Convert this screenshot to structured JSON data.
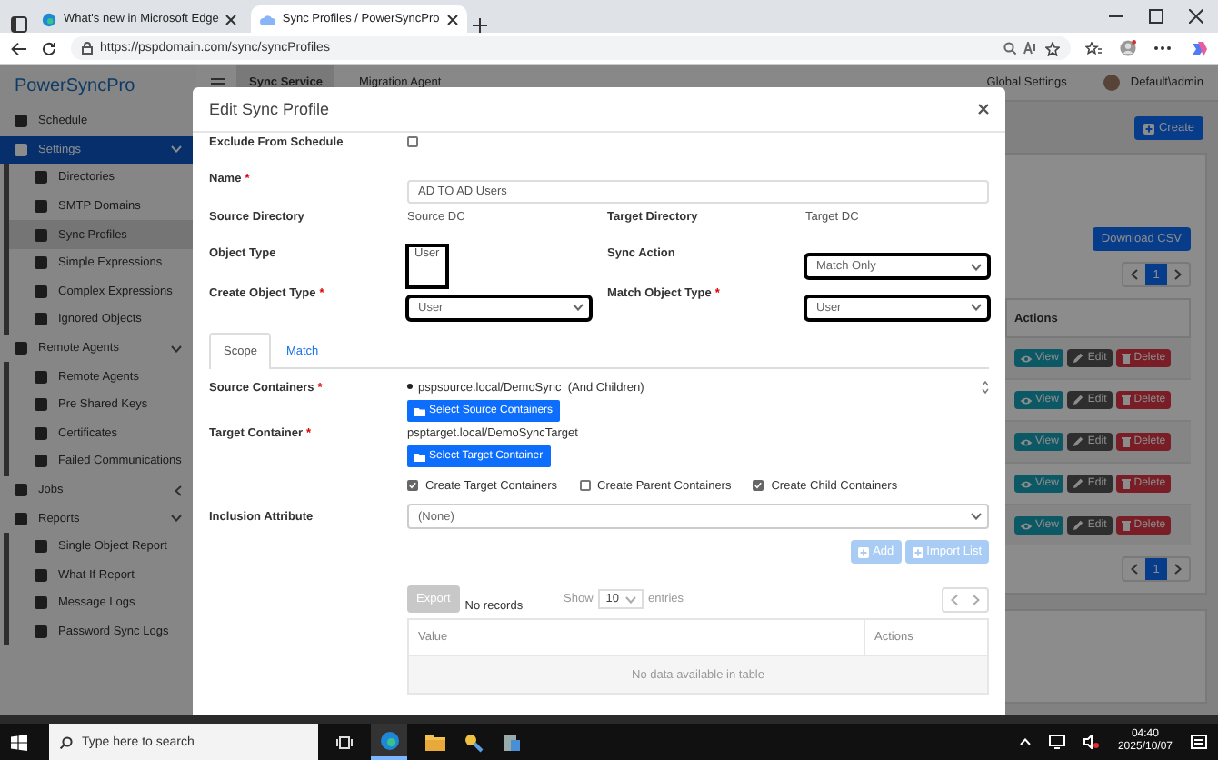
{
  "browser": {
    "tabs": [
      {
        "title": "What's new in Microsoft Edge",
        "selected": false
      },
      {
        "title": "Sync Profiles / PowerSyncPro",
        "selected": true
      }
    ],
    "url": "https://pspdomain.com/sync/syncProfiles"
  },
  "app": {
    "logo": "PowerSyncPro",
    "top_nav": [
      {
        "label": "Sync Service",
        "selected": true
      },
      {
        "label": "Migration Agent",
        "selected": false
      }
    ],
    "global_settings": "Global Settings",
    "user": "Default\\admin"
  },
  "sidebar": {
    "items": [
      {
        "label": "Schedule",
        "selected": false
      },
      {
        "label": "Settings",
        "selected": true,
        "expanded": true,
        "children": [
          {
            "label": "Directories",
            "selected": false
          },
          {
            "label": "SMTP Domains",
            "selected": false
          },
          {
            "label": "Sync Profiles",
            "selected": true
          },
          {
            "label": "Simple Expressions",
            "selected": false
          },
          {
            "label": "Complex Expressions",
            "selected": false
          },
          {
            "label": "Ignored Objects",
            "selected": false
          }
        ]
      },
      {
        "label": "Remote Agents",
        "selected": false,
        "expanded": true,
        "children": [
          {
            "label": "Remote Agents",
            "selected": false
          },
          {
            "label": "Pre Shared Keys",
            "selected": false
          },
          {
            "label": "Certificates",
            "selected": false
          },
          {
            "label": "Failed Communications",
            "selected": false
          }
        ]
      },
      {
        "label": "Jobs",
        "selected": false,
        "expanded": false
      },
      {
        "label": "Reports",
        "selected": false,
        "expanded": true,
        "children": [
          {
            "label": "Single Object Report",
            "selected": false
          },
          {
            "label": "What If Report",
            "selected": false
          },
          {
            "label": "Message Logs",
            "selected": false
          },
          {
            "label": "Password Sync Logs",
            "selected": false
          }
        ]
      }
    ]
  },
  "background": {
    "create_button": "Create",
    "download_button": "Download CSV",
    "pagers": [
      {
        "pages": [
          {
            "label": "1",
            "selected": true
          }
        ]
      },
      {
        "pages": [
          {
            "label": "1",
            "selected": true
          }
        ]
      }
    ],
    "table": {
      "columns": [
        "Actions"
      ],
      "rows": [
        {
          "actions": [
            "View",
            "Edit",
            "Delete"
          ]
        },
        {
          "actions": [
            "View",
            "Edit",
            "Delete"
          ]
        },
        {
          "actions": [
            "View",
            "Edit",
            "Delete"
          ]
        },
        {
          "actions": [
            "View",
            "Edit",
            "Delete"
          ]
        },
        {
          "actions": [
            "View",
            "Edit",
            "Delete"
          ]
        }
      ]
    }
  },
  "modal": {
    "title": "Edit Sync Profile",
    "exclude_from_schedule": {
      "label": "Exclude From Schedule",
      "checked": false
    },
    "name": {
      "label": "Name",
      "required_mark": "*",
      "value": "AD TO AD Users"
    },
    "source_directory": {
      "label": "Source Directory",
      "value": "Source DC"
    },
    "target_directory": {
      "label": "Target Directory",
      "value": "Target DC"
    },
    "object_type": {
      "label": "Object Type",
      "value": "User",
      "highlighted": true
    },
    "sync_action": {
      "label": "Sync Action",
      "value": "Match Only",
      "highlighted": true
    },
    "create_object_type": {
      "label": "Create Object Type",
      "required_mark": "*",
      "value": "User",
      "highlighted": true
    },
    "match_object_type": {
      "label": "Match Object Type",
      "required_mark": "*",
      "value": "User",
      "highlighted": true
    },
    "tabs": [
      {
        "label": "Scope",
        "selected": true
      },
      {
        "label": "Match",
        "selected": false
      }
    ],
    "source_containers": {
      "label": "Source Containers",
      "required_mark": "*",
      "items": [
        "pspsource.local/DemoSync  (And Children)"
      ],
      "button": "Select Source Containers"
    },
    "target_container": {
      "label": "Target Container",
      "required_mark": "*",
      "value": "psptarget.local/DemoSyncTarget",
      "button": "Select Target Container"
    },
    "container_options": [
      {
        "label": "Create Target Containers",
        "checked": true
      },
      {
        "label": "Create Parent Containers",
        "checked": false
      },
      {
        "label": "Create Child Containers",
        "checked": true
      }
    ],
    "inclusion_attribute": {
      "label": "Inclusion Attribute",
      "value": "(None)"
    },
    "list_buttons": [
      {
        "label": "Add",
        "disabled": true
      },
      {
        "label": "Import List",
        "disabled": true
      }
    ],
    "export_button": {
      "label": "Export",
      "disabled": true
    },
    "record_count": "No records",
    "page_length": {
      "before": "Show",
      "value": "10",
      "after": "entries"
    },
    "values_table": {
      "columns": [
        "Value",
        "Actions"
      ],
      "empty_message": "No data available in table"
    }
  },
  "taskbar": {
    "search_placeholder": "Type here to search",
    "time": "04:40",
    "date": "2025/10/07"
  }
}
